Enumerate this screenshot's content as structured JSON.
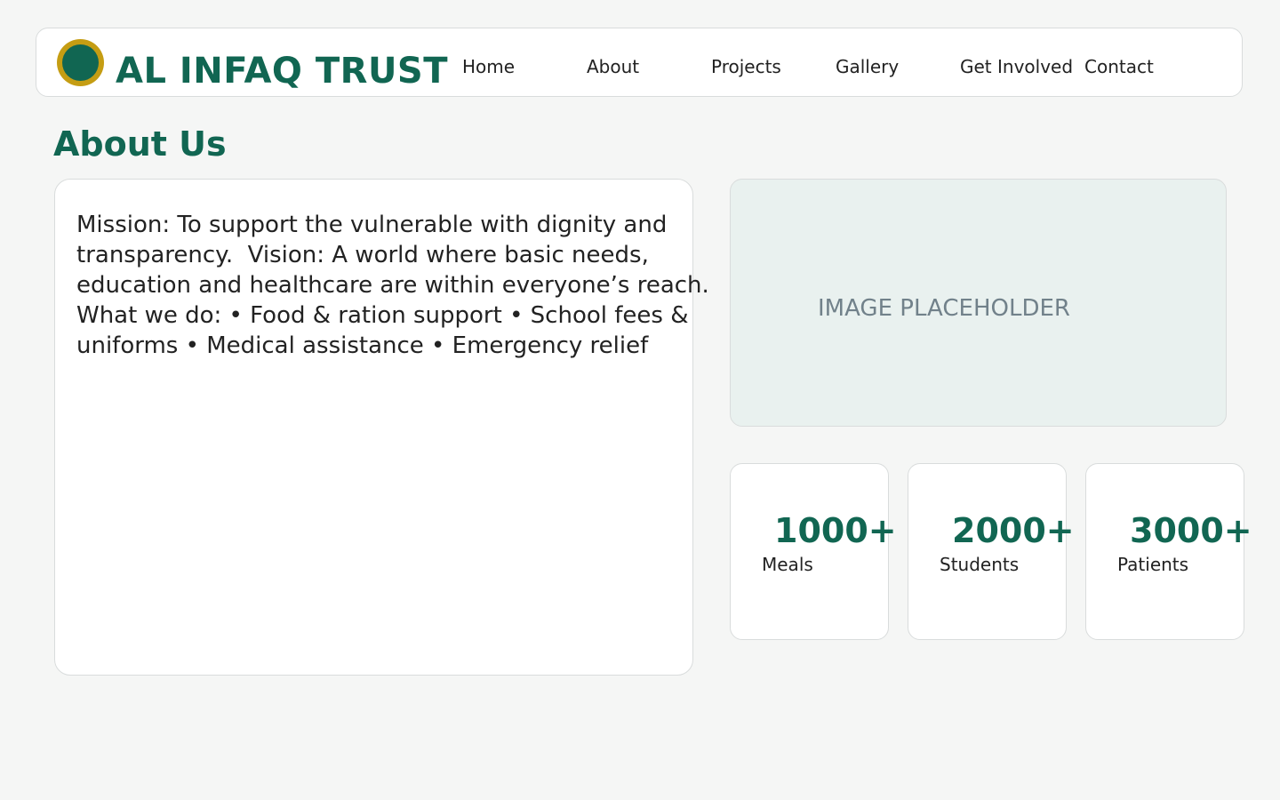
{
  "header": {
    "brand_name": "AL INFAQ TRUST",
    "nav": [
      {
        "label": "Home"
      },
      {
        "label": "About"
      },
      {
        "label": "Projects"
      },
      {
        "label": "Gallery"
      },
      {
        "label": "Get Involved"
      },
      {
        "label": "Contact"
      }
    ]
  },
  "about": {
    "title": "About Us",
    "text": "Mission: To support the vulnerable with dignity and\ntransparency.  Vision: A world where basic needs,\neducation and healthcare are within everyone’s reach.\nWhat we do: • Food & ration support • School fees &\nuniforms • Medical assistance • Emergency relief"
  },
  "image": {
    "placeholder_label": "IMAGE PLACEHOLDER"
  },
  "stats": [
    {
      "value": "1000+",
      "label": "Meals"
    },
    {
      "value": "2000+",
      "label": "Students"
    },
    {
      "value": "3000+",
      "label": "Patients"
    }
  ],
  "colors": {
    "brand": "#116652",
    "logo_ring": "#c59d13",
    "page_background": "#f5f6f5",
    "image_background": "#e9f1ef"
  }
}
